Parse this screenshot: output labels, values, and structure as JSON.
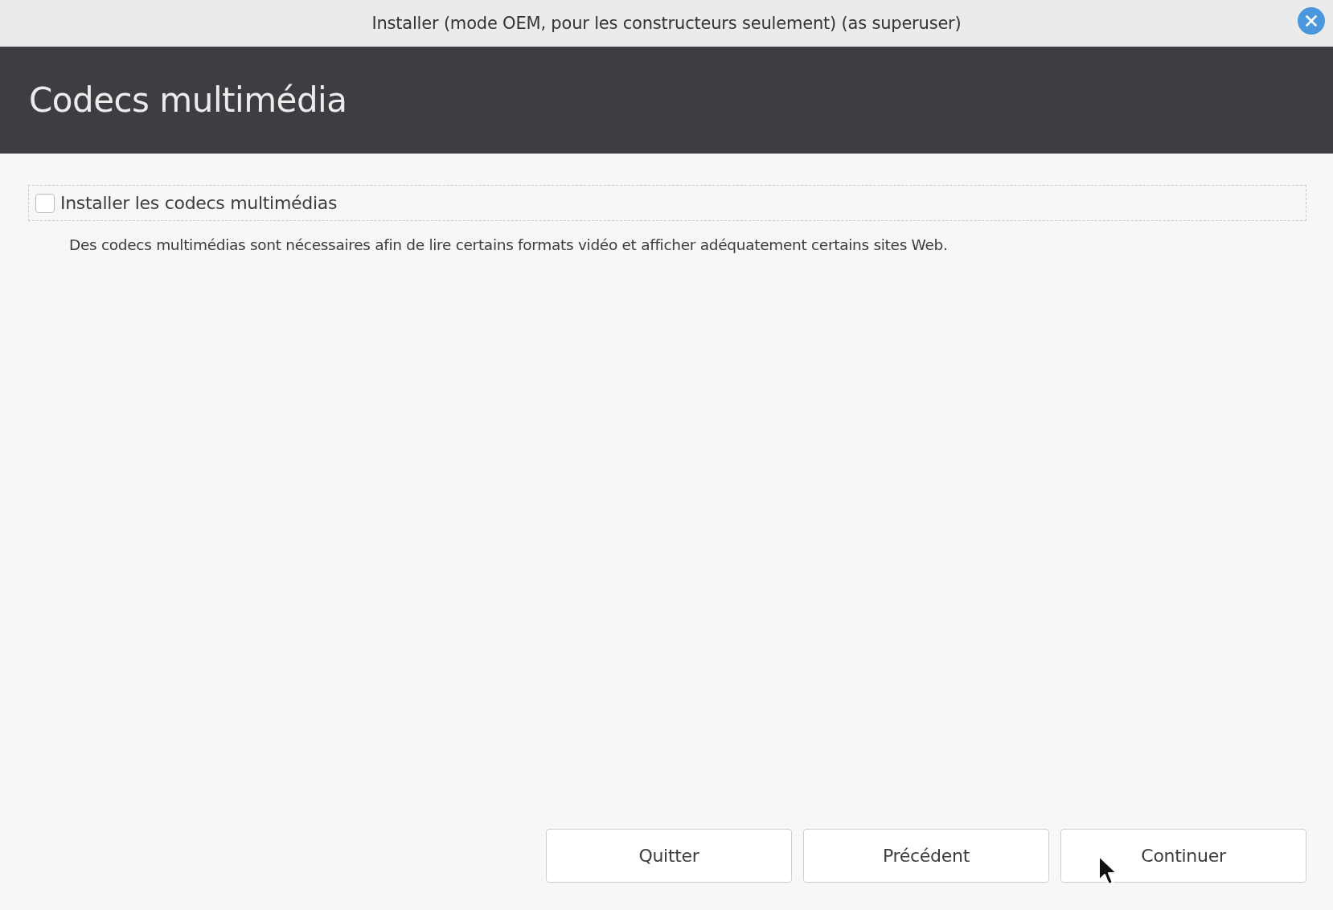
{
  "window": {
    "title": "Installer (mode OEM, pour les constructeurs seulement) (as superuser)"
  },
  "header": {
    "title": "Codecs multimédia"
  },
  "options": [
    {
      "label": "Installer les codecs multimédias",
      "checked": false,
      "focused": true,
      "description": "Des codecs multimédias sont nécessaires afin de lire certains formats vidéo et afficher adéquatement certains sites Web."
    }
  ],
  "buttons": [
    {
      "label": "Quitter"
    },
    {
      "label": "Précédent"
    },
    {
      "label": "Continuer"
    }
  ]
}
